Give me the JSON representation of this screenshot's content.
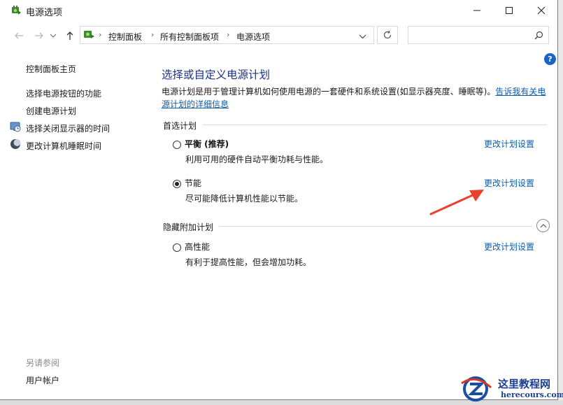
{
  "window": {
    "title": "电源选项"
  },
  "address": {
    "crumbs": [
      "控制面板",
      "所有控制面板项",
      "电源选项"
    ]
  },
  "search": {
    "placeholder": ""
  },
  "left_pane": {
    "home_link": "控制面板主页",
    "links": [
      "选择电源按钮的功能",
      "创建电源计划",
      "选择关闭显示器的时间",
      "更改计算机睡眠时间"
    ],
    "see_also_label": "另请参阅",
    "see_also_links": [
      "用户帐户"
    ]
  },
  "main": {
    "title": "选择或自定义电源计划",
    "description": "电源计划是用于管理计算机如何使用电源的一套硬件和系统设置(如显示器亮度、睡眠等)。",
    "description_link": "告诉我有关电源计划的详细信息",
    "preferred_label": "首选计划",
    "hidden_label": "隐藏附加计划",
    "plans": [
      {
        "name": "平衡 (推荐)",
        "desc": "利用可用的硬件自动平衡功耗与性能。",
        "selected": false,
        "change_link": "更改计划设置"
      },
      {
        "name": "节能",
        "desc": "尽可能降低计算机性能以节能。",
        "selected": true,
        "change_link": "更改计划设置"
      },
      {
        "name": "高性能",
        "desc": "有利于提高性能，但会增加功耗。",
        "selected": false,
        "change_link": "更改计划设置"
      }
    ]
  },
  "help": {
    "label": "?"
  },
  "watermark": {
    "name": "这里教程网",
    "url": "herecours.com"
  },
  "colors": {
    "link": "#0b5cad",
    "title": "#1e3287",
    "annotation_arrow": "#e8412c"
  }
}
